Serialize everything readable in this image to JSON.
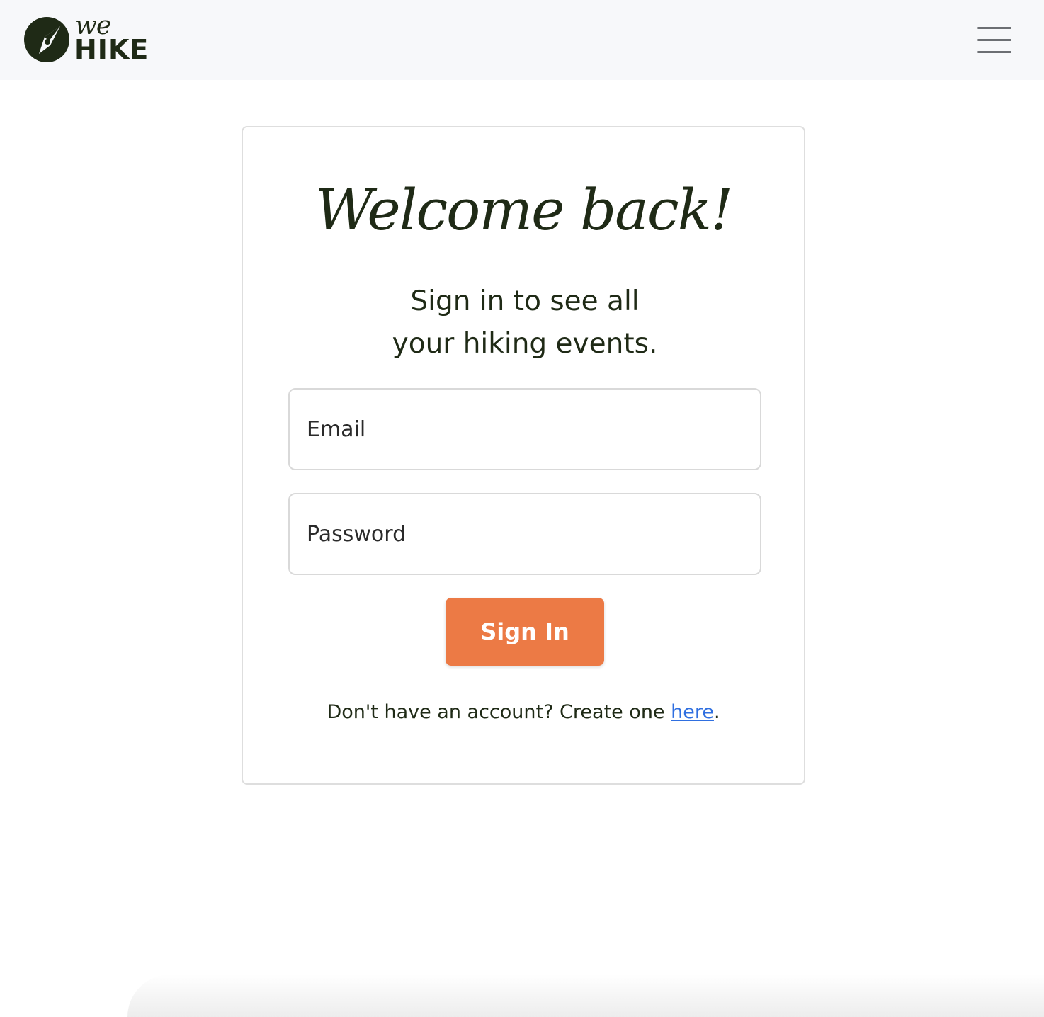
{
  "navbar": {
    "brand": {
      "we": "we",
      "hike": "HIKE"
    },
    "menu_icon": "hamburger-menu-icon"
  },
  "login": {
    "title": "Welcome back!",
    "subtitle": "Sign in to see all your hiking events.",
    "email_placeholder": "Email",
    "email_value": "",
    "password_placeholder": "Password",
    "password_value": "",
    "submit_label": "Sign In",
    "account_prefix": "Don't have an account? Create one ",
    "account_link": "here",
    "account_suffix": "."
  },
  "colors": {
    "brand_dark": "#1f2a16",
    "accent": "#ec7a45",
    "link": "#2f6fe0",
    "navbar_bg": "#f7f8fa"
  }
}
